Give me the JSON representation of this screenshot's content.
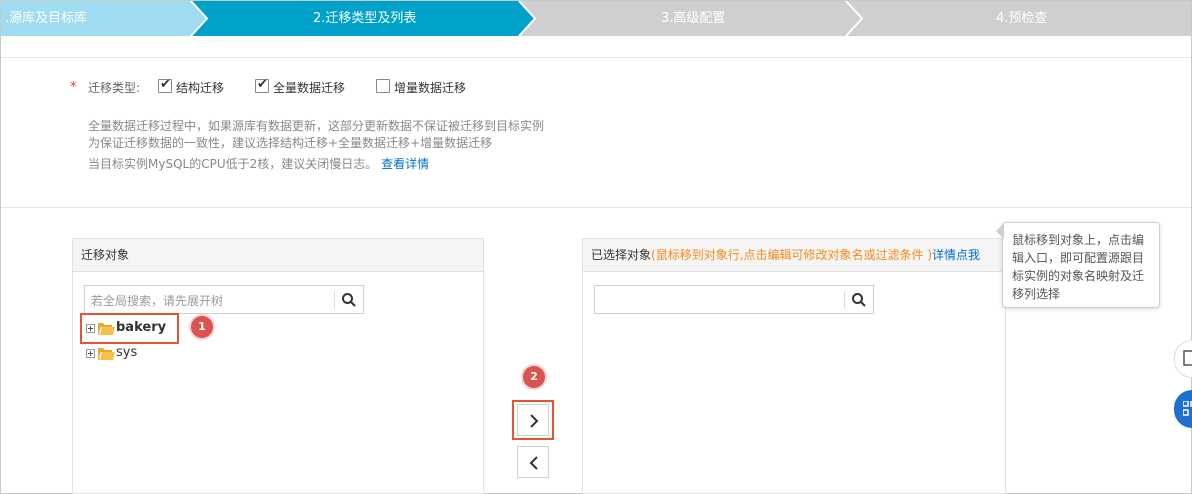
{
  "steps": [
    {
      "label": ".源库及目标库",
      "state": "done"
    },
    {
      "label": "2.迁移类型及列表",
      "state": "active"
    },
    {
      "label": "3.高级配置",
      "state": "todo"
    },
    {
      "label": "4.预检查",
      "state": "todo"
    }
  ],
  "migration_type": {
    "required_mark": "*",
    "label": "迁移类型:",
    "options": [
      {
        "label": "结构迁移",
        "checked": true
      },
      {
        "label": "全量数据迁移",
        "checked": true
      },
      {
        "label": "增量数据迁移",
        "checked": false
      }
    ]
  },
  "notes": {
    "line1": "全量数据迁移过程中，如果源库有数据更新，这部分更新数据不保证被迁移到目标实例",
    "line2": "为保证迁移数据的一致性，建议选择结构迁移+全量数据迁移+增量数据迁移",
    "line3": "当目标实例MySQL的CPU低于2核，建议关闭慢日志。",
    "link": "查看详情"
  },
  "left_panel": {
    "title": "迁移对象",
    "search_placeholder": "若全局搜索，请先展开树",
    "tree": [
      {
        "label": "bakery",
        "bold": true
      },
      {
        "label": "sys",
        "bold": false
      }
    ]
  },
  "right_panel": {
    "title": "已选择对象",
    "hint": "(鼠标移到对象行,点击编辑可修改对象名或过滤条件 )",
    "link": "详情点我",
    "search_value": ""
  },
  "tooltip": {
    "text": "鼠标移到对象上，点击编辑入口，即可配置源跟目标实例的对象名映射及迁移列选择"
  },
  "annotations": {
    "badge1": "1",
    "badge2": "2"
  },
  "colors": {
    "step_done": "#9fdcf2",
    "step_active": "#00a2ca",
    "step_todo": "#cfcfcf",
    "highlight": "#e4562f",
    "badge": "#d9534f",
    "link": "#0070cc",
    "hint": "#f7891a"
  }
}
